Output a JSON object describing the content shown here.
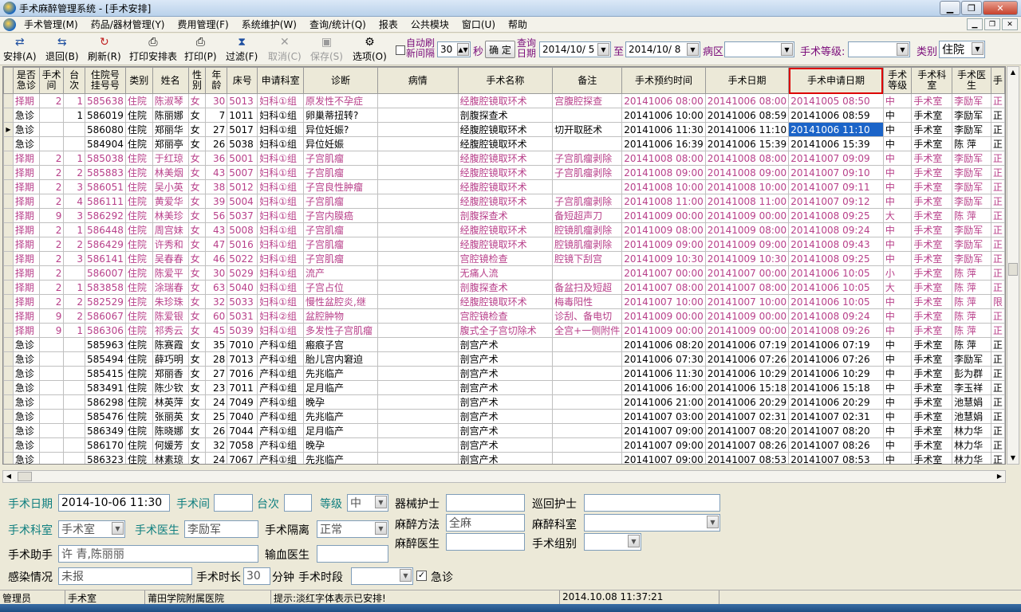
{
  "window": {
    "title": "手术麻醉管理系统 - [手术安排]"
  },
  "menu": [
    "手术管理(M)",
    "药品/器材管理(Y)",
    "费用管理(F)",
    "系统维护(W)",
    "查询/统计(Q)",
    "报表",
    "公共模块",
    "窗口(U)",
    "帮助"
  ],
  "toolbar": {
    "arrange": "安排(A)",
    "back": "退回(B)",
    "refresh": "刷新(R)",
    "print_schedule": "打印安排表",
    "print": "打印(P)",
    "filter": "过滤(F)",
    "cancel": "取消(C)",
    "save": "保存(S)",
    "options": "选项(O)",
    "auto_refresh_label1": "自动刷",
    "auto_refresh_label2": "新间隔",
    "auto_refresh_value": "30",
    "seconds_label": "秒",
    "confirm_label": "确 定",
    "query_date_label1": "查询",
    "query_date_label2": "日期",
    "date_from": "2014/10/ 5",
    "to_label": "至",
    "date_to": "2014/10/ 8",
    "ward_label": "病区",
    "ward_value": "",
    "level_label": "手术等级:",
    "level_value": "",
    "category_label": "类别",
    "category_value": "住院"
  },
  "grid": {
    "columns": [
      "是否急诊",
      "手术间",
      "台次",
      "住院号挂号号",
      "类别",
      "姓名",
      "性别",
      "年龄",
      "床号",
      "申请科室",
      "诊断",
      "病情",
      "手术名称",
      "备注",
      "手术预约时间",
      "手术日期",
      "手术申请日期",
      "手术等级",
      "手术科室",
      "手术医生",
      "手"
    ],
    "rows": [
      {
        "c": [
          "择期",
          "2",
          "1",
          "585638",
          "住院",
          "陈淑琴",
          "女",
          "30",
          "5013",
          "妇科①组",
          "原发性不孕症",
          "",
          "经腹腔镜取环术",
          "宫腹腔探查",
          "20141006 08:00",
          "20141006 08:00",
          "20141005 08:50",
          "中",
          "手术室",
          "李励军",
          "正"
        ],
        "pink": true
      },
      {
        "c": [
          "急诊",
          "",
          "1",
          "586019",
          "住院",
          "陈丽娜",
          "女",
          "7",
          "1011",
          "妇科①组",
          "卵巢蒂扭转?",
          "",
          "剖腹探查术",
          "",
          "20141006 10:00",
          "20141006 08:59",
          "20141006 08:59",
          "中",
          "手术室",
          "李励军",
          "正"
        ],
        "pink": false
      },
      {
        "c": [
          "急诊",
          "",
          "",
          "586080",
          "住院",
          "郑丽华",
          "女",
          "27",
          "5017",
          "妇科①组",
          "异位妊娠?",
          "",
          "经腹腔镜取环术",
          "切开取胚术",
          "20141006 11:30",
          "20141006 11:10",
          "20141006 11:10",
          "中",
          "手术室",
          "李励军",
          "正"
        ],
        "pink": false,
        "current": true
      },
      {
        "c": [
          "急诊",
          "",
          "",
          "584904",
          "住院",
          "郑丽亭",
          "女",
          "26",
          "5038",
          "妇科①组",
          "异位妊娠",
          "",
          "经腹腔镜取环术",
          "",
          "20141006 16:39",
          "20141006 15:39",
          "20141006 15:39",
          "中",
          "手术室",
          "陈 萍",
          "正"
        ],
        "pink": false
      },
      {
        "c": [
          "择期",
          "2",
          "1",
          "585038",
          "住院",
          "于红琼",
          "女",
          "36",
          "5001",
          "妇科①组",
          "子宫肌瘤",
          "",
          "经腹腔镜取环术",
          "子宫肌瘤剥除",
          "20141008 08:00",
          "20141008 08:00",
          "20141007 09:09",
          "中",
          "手术室",
          "李励军",
          "正"
        ],
        "pink": true
      },
      {
        "c": [
          "择期",
          "2",
          "2",
          "585883",
          "住院",
          "林美烟",
          "女",
          "43",
          "5007",
          "妇科①组",
          "子宫肌瘤",
          "",
          "经腹腔镜取环术",
          "子宫肌瘤剥除",
          "20141008 09:00",
          "20141008 09:00",
          "20141007 09:10",
          "中",
          "手术室",
          "李励军",
          "正"
        ],
        "pink": true
      },
      {
        "c": [
          "择期",
          "2",
          "3",
          "586051",
          "住院",
          "吴小英",
          "女",
          "38",
          "5012",
          "妇科①组",
          "子宫良性肿瘤",
          "",
          "经腹腔镜取环术",
          "",
          "20141008 10:00",
          "20141008 10:00",
          "20141007 09:11",
          "中",
          "手术室",
          "李励军",
          "正"
        ],
        "pink": true
      },
      {
        "c": [
          "择期",
          "2",
          "4",
          "586111",
          "住院",
          "黄爱华",
          "女",
          "39",
          "5004",
          "妇科①组",
          "子宫肌瘤",
          "",
          "经腹腔镜取环术",
          "子宫肌瘤剥除",
          "20141008 11:00",
          "20141008 11:00",
          "20141007 09:12",
          "中",
          "手术室",
          "李励军",
          "正"
        ],
        "pink": true
      },
      {
        "c": [
          "择期",
          "9",
          "3",
          "586292",
          "住院",
          "林美珍",
          "女",
          "56",
          "5037",
          "妇科①组",
          "子宫内膜癌",
          "",
          "剖腹探查术",
          "备短超声刀",
          "20141009 00:00",
          "20141009 00:00",
          "20141008 09:25",
          "大",
          "手术室",
          "陈 萍",
          "正"
        ],
        "pink": true
      },
      {
        "c": [
          "择期",
          "2",
          "1",
          "586448",
          "住院",
          "周宫妹",
          "女",
          "43",
          "5008",
          "妇科①组",
          "子宫肌瘤",
          "",
          "经腹腔镜取环术",
          "腔镜肌瘤剥除",
          "20141009 08:00",
          "20141009 08:00",
          "20141008 09:24",
          "中",
          "手术室",
          "李励军",
          "正"
        ],
        "pink": true
      },
      {
        "c": [
          "择期",
          "2",
          "2",
          "586429",
          "住院",
          "许秀和",
          "女",
          "47",
          "5016",
          "妇科①组",
          "子宫肌瘤",
          "",
          "经腹腔镜取环术",
          "腔镜肌瘤剥除",
          "20141009 09:00",
          "20141009 09:00",
          "20141008 09:43",
          "中",
          "手术室",
          "李励军",
          "正"
        ],
        "pink": true
      },
      {
        "c": [
          "择期",
          "2",
          "3",
          "586141",
          "住院",
          "吴春春",
          "女",
          "46",
          "5022",
          "妇科①组",
          "子宫肌瘤",
          "",
          "宫腔镜检查",
          "腔镜下刮宫",
          "20141009 10:30",
          "20141009 10:30",
          "20141008 09:25",
          "中",
          "手术室",
          "李励军",
          "正"
        ],
        "pink": true
      },
      {
        "c": [
          "择期",
          "2",
          "",
          "586007",
          "住院",
          "陈爱平",
          "女",
          "30",
          "5029",
          "妇科①组",
          "流产",
          "",
          "无痛人流",
          "",
          "20141007 00:00",
          "20141007 00:00",
          "20141006 10:05",
          "小",
          "手术室",
          "陈 萍",
          "正"
        ],
        "pink": true
      },
      {
        "c": [
          "择期",
          "2",
          "1",
          "583858",
          "住院",
          "涂瑞春",
          "女",
          "63",
          "5040",
          "妇科①组",
          "子宫占位",
          "",
          "剖腹探查术",
          "备盆扫及短超",
          "20141007 08:00",
          "20141007 08:00",
          "20141006 10:05",
          "大",
          "手术室",
          "陈 萍",
          "正"
        ],
        "pink": true
      },
      {
        "c": [
          "择期",
          "2",
          "2",
          "582529",
          "住院",
          "朱珍珠",
          "女",
          "32",
          "5033",
          "妇科①组",
          "慢性盆腔炎,继",
          "",
          "经腹腔镜取环术",
          "梅毒阳性",
          "20141007 10:00",
          "20141007 10:00",
          "20141006 10:05",
          "中",
          "手术室",
          "陈 萍",
          "限"
        ],
        "pink": true
      },
      {
        "c": [
          "择期",
          "9",
          "2",
          "586067",
          "住院",
          "陈爱银",
          "女",
          "60",
          "5031",
          "妇科②组",
          "盆腔肿物",
          "",
          "宫腔镜检查",
          "诊刮、备电切",
          "20141009 00:00",
          "20141009 00:00",
          "20141008 09:24",
          "中",
          "手术室",
          "陈 萍",
          "正"
        ],
        "pink": true
      },
      {
        "c": [
          "择期",
          "9",
          "1",
          "586306",
          "住院",
          "祁秀云",
          "女",
          "45",
          "5039",
          "妇科①组",
          "多发性子宫肌瘤",
          "",
          "腹式全子宫切除术",
          "全宫+一侧附件",
          "20141009 00:00",
          "20141009 00:00",
          "20141008 09:26",
          "中",
          "手术室",
          "陈 萍",
          "正"
        ],
        "pink": true
      },
      {
        "c": [
          "急诊",
          "",
          "",
          "585963",
          "住院",
          "陈赛霞",
          "女",
          "35",
          "7010",
          "产科①组",
          "瘢痕子宫",
          "",
          "剖宫产术",
          "",
          "20141006 08:20",
          "20141006 07:19",
          "20141006 07:19",
          "中",
          "手术室",
          "陈 萍",
          "正"
        ],
        "pink": false
      },
      {
        "c": [
          "急诊",
          "",
          "",
          "585494",
          "住院",
          "薛巧明",
          "女",
          "28",
          "7013",
          "产科①组",
          "胎儿宫内窘迫",
          "",
          "剖宫产术",
          "",
          "20141006 07:30",
          "20141006 07:26",
          "20141006 07:26",
          "中",
          "手术室",
          "李励军",
          "正"
        ],
        "pink": false
      },
      {
        "c": [
          "急诊",
          "",
          "",
          "585415",
          "住院",
          "郑丽香",
          "女",
          "27",
          "7016",
          "产科①组",
          "先兆临产",
          "",
          "剖宫产术",
          "",
          "20141006 11:30",
          "20141006 10:29",
          "20141006 10:29",
          "中",
          "手术室",
          "彭为群",
          "正"
        ],
        "pink": false
      },
      {
        "c": [
          "急诊",
          "",
          "",
          "583491",
          "住院",
          "陈少钦",
          "女",
          "23",
          "7011",
          "产科①组",
          "足月临产",
          "",
          "剖宫产术",
          "",
          "20141006 16:00",
          "20141006 15:18",
          "20141006 15:18",
          "中",
          "手术室",
          "李玉祥",
          "正"
        ],
        "pink": false
      },
      {
        "c": [
          "急诊",
          "",
          "",
          "586298",
          "住院",
          "林英萍",
          "女",
          "24",
          "7049",
          "产科①组",
          "晚孕",
          "",
          "剖宫产术",
          "",
          "20141006 21:00",
          "20141006 20:29",
          "20141006 20:29",
          "中",
          "手术室",
          "池慧娟",
          "正"
        ],
        "pink": false
      },
      {
        "c": [
          "急诊",
          "",
          "",
          "585476",
          "住院",
          "张丽英",
          "女",
          "25",
          "7040",
          "产科①组",
          "先兆临产",
          "",
          "剖宫产术",
          "",
          "20141007 03:00",
          "20141007 02:31",
          "20141007 02:31",
          "中",
          "手术室",
          "池慧娟",
          "正"
        ],
        "pink": false
      },
      {
        "c": [
          "急诊",
          "",
          "",
          "586349",
          "住院",
          "陈晓娜",
          "女",
          "26",
          "7044",
          "产科①组",
          "足月临产",
          "",
          "剖宫产术",
          "",
          "20141007 09:00",
          "20141007 08:20",
          "20141007 08:20",
          "中",
          "手术室",
          "林力华",
          "正"
        ],
        "pink": false
      },
      {
        "c": [
          "急诊",
          "",
          "",
          "586170",
          "住院",
          "何媛芳",
          "女",
          "32",
          "7058",
          "产科①组",
          "晚孕",
          "",
          "剖宫产术",
          "",
          "20141007 09:00",
          "20141007 08:26",
          "20141007 08:26",
          "中",
          "手术室",
          "林力华",
          "正"
        ],
        "pink": false
      },
      {
        "c": [
          "急诊",
          "",
          "",
          "586323",
          "住院",
          "林素琼",
          "女",
          "24",
          "7067",
          "产科①组",
          "先兆临产",
          "",
          "剖宫产术",
          "",
          "20141007 09:00",
          "20141007 08:53",
          "20141007 08:53",
          "中",
          "手术室",
          "林力华",
          "正"
        ],
        "pink": false
      }
    ]
  },
  "detail": {
    "surgery_date_label": "手术日期",
    "surgery_date_value": "2014-10-06 11:30",
    "room_label": "手术间",
    "room_value": "",
    "order_label": "台次",
    "order_value": "",
    "grade_label": "等级",
    "grade_value": "中",
    "instrument_nurse_label": "器械护士",
    "instrument_nurse_value": "",
    "circulating_nurse_label": "巡回护士",
    "circulating_nurse_value": "",
    "dept_label": "手术科室",
    "dept_value": "手术室",
    "doctor_label": "手术医生",
    "doctor_value": "李励军",
    "isolation_label": "手术隔离",
    "isolation_value": "正常",
    "anesthesia_method_label": "麻醉方法",
    "anesthesia_method_value": "全麻",
    "anesthesia_dept_label": "麻醉科室",
    "anesthesia_dept_value": "",
    "assistant_label": "手术助手",
    "assistant_value": "许 青,陈丽丽",
    "transfusion_label": "输血医生",
    "transfusion_value": "",
    "anesthesiologist_label": "麻醉医生",
    "anesthesiologist_value": "",
    "team_label": "手术组别",
    "team_value": "",
    "infection_label": "感染情况",
    "infection_value": "未报",
    "duration_label": "手术时长",
    "duration_value": "30",
    "minutes_label": "分钟",
    "period_label": "手术时段",
    "period_value": "",
    "emergency_label": "急诊"
  },
  "status": {
    "user": "管理员",
    "dept": "手术室",
    "hospital": "莆田学院附属医院",
    "hint": "提示:淡红字体表示已安排!",
    "datetime": "2014.10.08 11:37:21"
  }
}
